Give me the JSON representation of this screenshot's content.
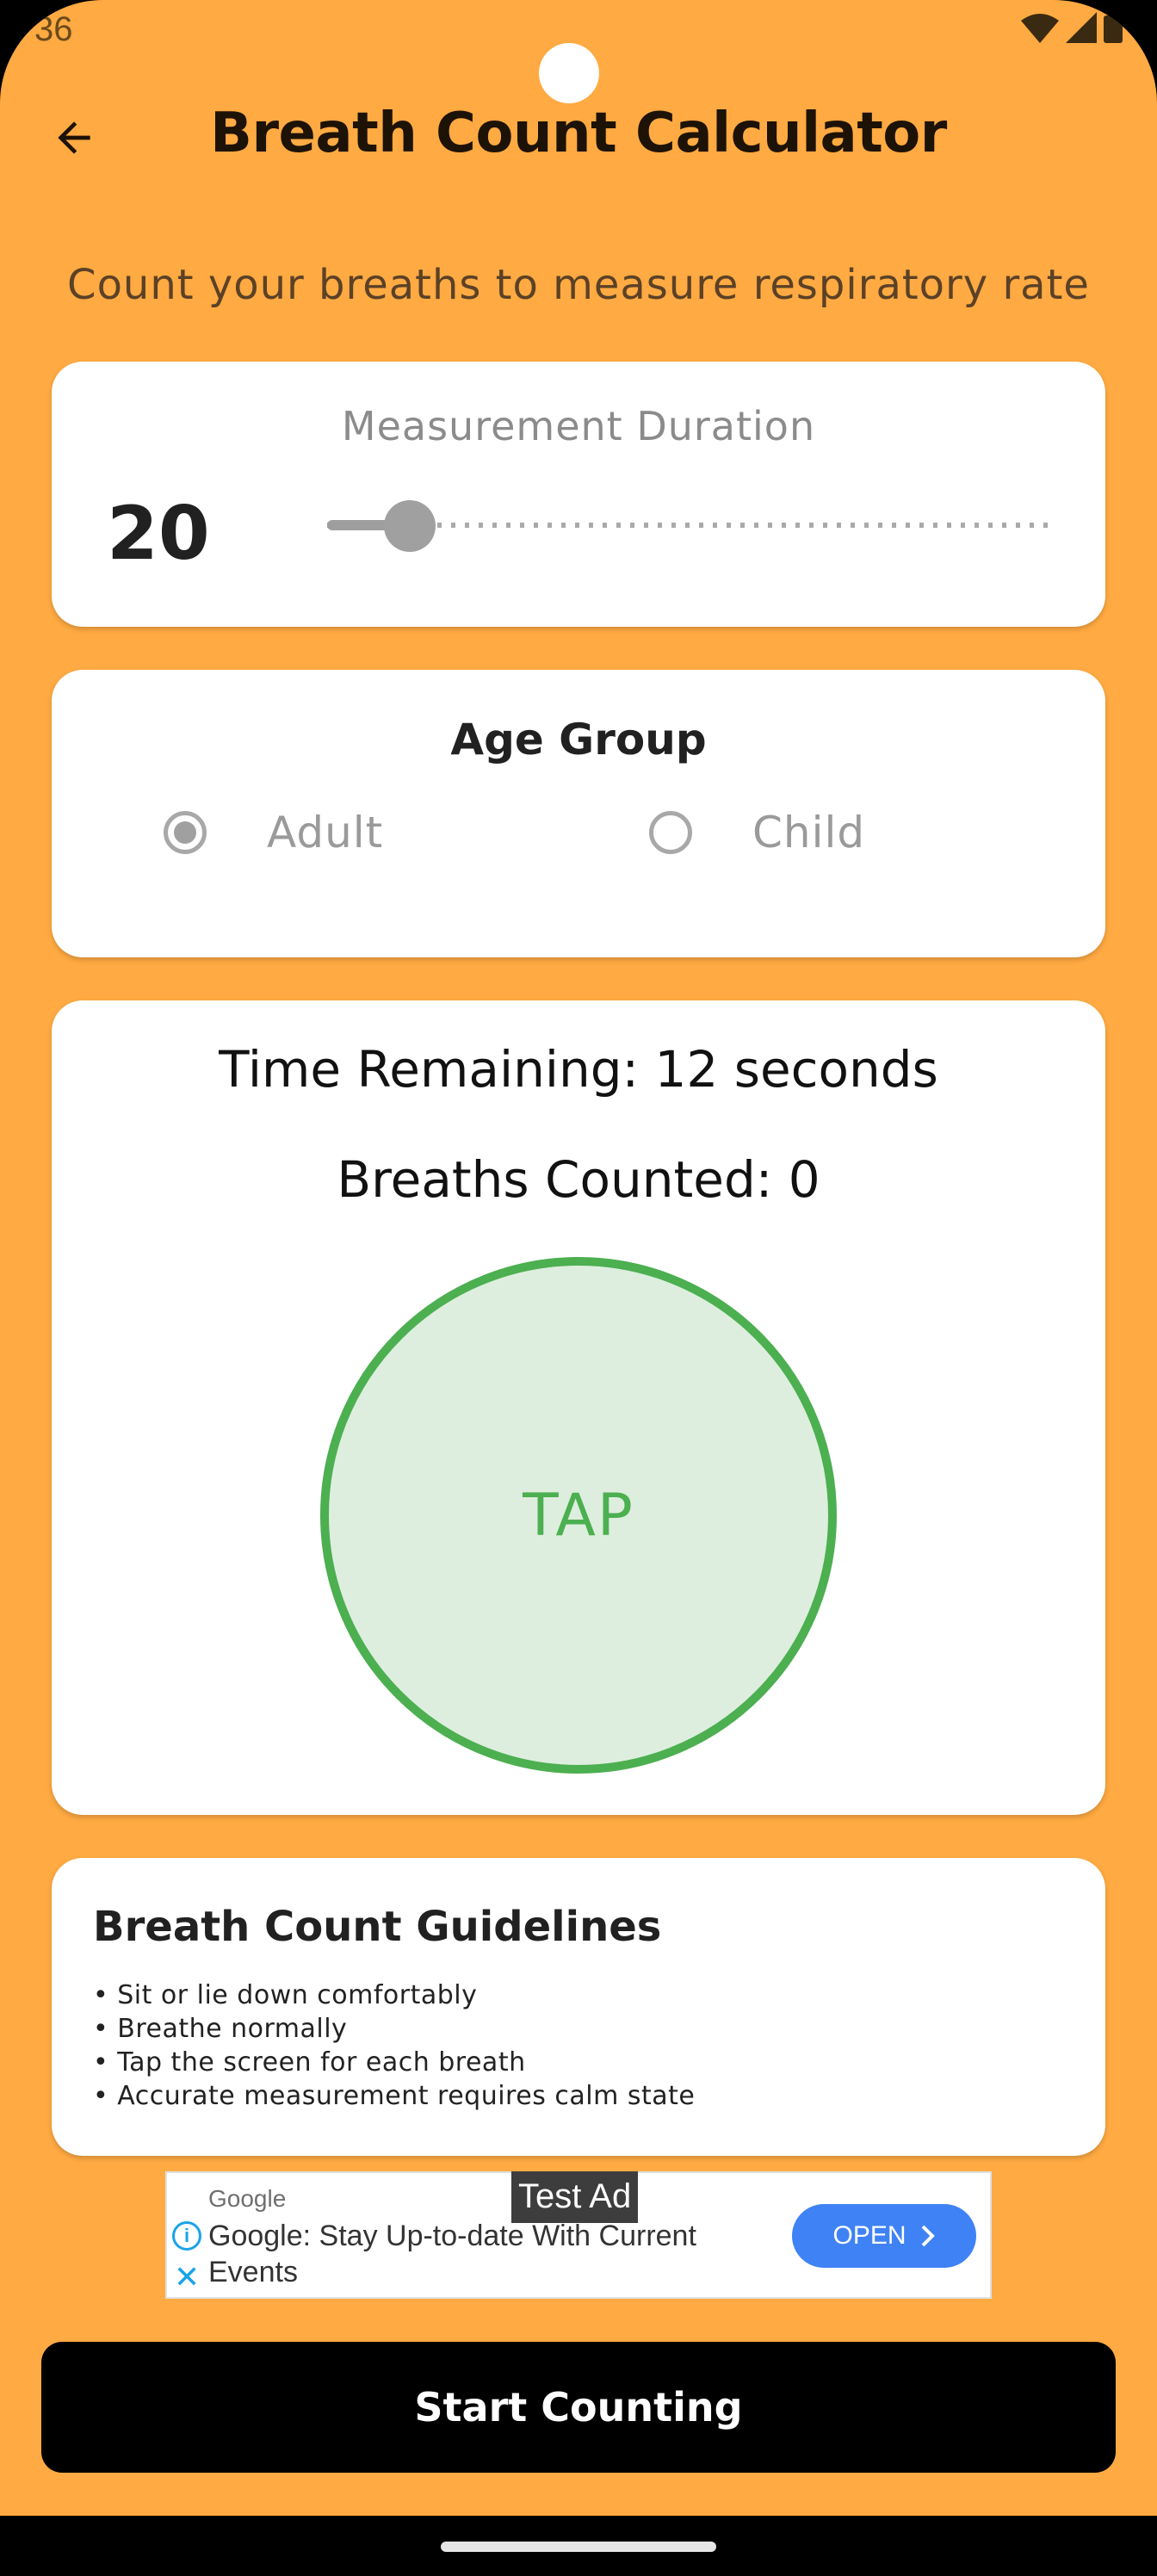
{
  "status_bar": {
    "time": "36"
  },
  "app_bar": {
    "title": "Breath Count Calculator",
    "back_icon": "arrow-back-icon"
  },
  "subtitle": "Count your breaths to measure respiratory rate",
  "duration": {
    "label": "Measurement Duration",
    "value": "20",
    "slider_fraction": 0.05
  },
  "age_group": {
    "title": "Age Group",
    "options": [
      {
        "label": "Adult",
        "selected": true
      },
      {
        "label": "Child",
        "selected": false
      }
    ]
  },
  "counter": {
    "time_remaining": "Time Remaining: 12 seconds",
    "breaths_counted": "Breaths Counted: 0",
    "tap_label": "TAP"
  },
  "guidelines": {
    "title": "Breath Count Guidelines",
    "items": [
      "• Sit or lie down comfortably",
      "• Breathe normally",
      "• Tap the screen for each breath",
      "• Accurate measurement requires calm state"
    ]
  },
  "ad": {
    "advertiser": "Google",
    "text": "Google: Stay Up-to-date With Current Events",
    "badge": "Test Ad",
    "cta": "OPEN"
  },
  "start_button": "Start Counting",
  "colors": {
    "background": "#FFAA42",
    "accent_green": "#4CAF50",
    "ad_blue": "#3F82F5"
  }
}
